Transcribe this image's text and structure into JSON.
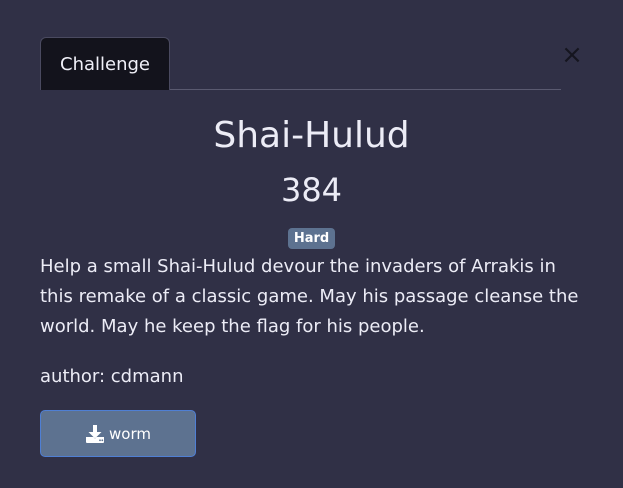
{
  "tabs": [
    {
      "label": "Challenge",
      "active": true
    }
  ],
  "close_label": "×",
  "challenge": {
    "name": "Shai-Hulud",
    "points": "384",
    "difficulty": "Hard",
    "description": "Help a small Shai-Hulud devour the invaders of Arrakis in this remake of a classic game. May his passage cleanse the world. May he keep the flag for his people.",
    "author": "author: cdmann"
  },
  "files": [
    {
      "label": "worm",
      "icon": "download-icon"
    }
  ],
  "colors": {
    "background": "#303046",
    "tab_active_bg": "#13131c",
    "badge_bg": "#5d7290",
    "button_bg": "#5d7290",
    "button_border": "#4f7fd4"
  }
}
